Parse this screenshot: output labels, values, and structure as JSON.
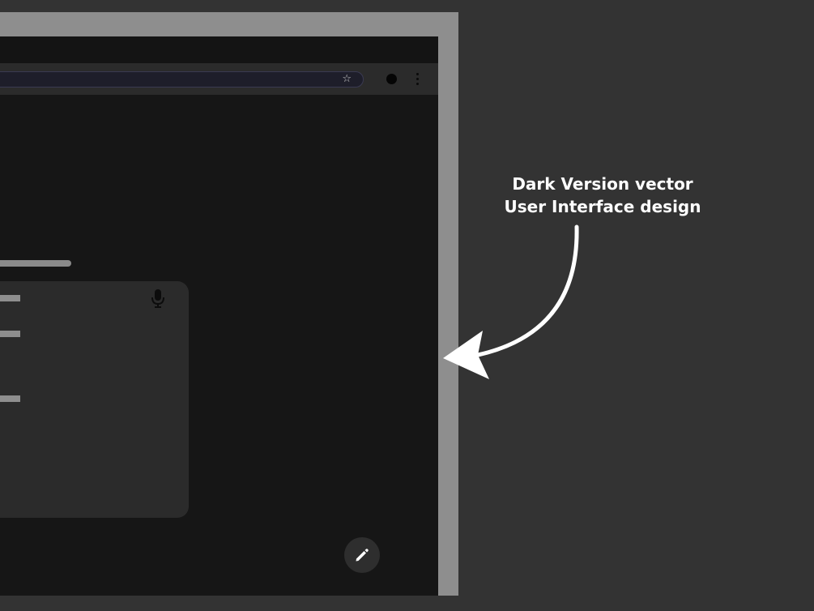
{
  "annotation": {
    "line1": "Dark Version vector",
    "line2": "User Interface design"
  },
  "browser": {
    "bookmark_icon": "star-icon",
    "star_glyph": "☆",
    "profile_icon": "profile-avatar-icon",
    "menu_icon": "more-vert-icon"
  },
  "search_card": {
    "voice_icon": "microphone-icon"
  },
  "fab": {
    "icon": "pencil-icon"
  },
  "colors": {
    "page_background": "#333333",
    "device_frame": "#8e8e8e",
    "screen_background": "#161616",
    "toolbar": "#2b2b2b",
    "card": "#2b2b2b",
    "placeholder_lines": "#8e8e8e",
    "annotation_text": "#ffffff"
  }
}
